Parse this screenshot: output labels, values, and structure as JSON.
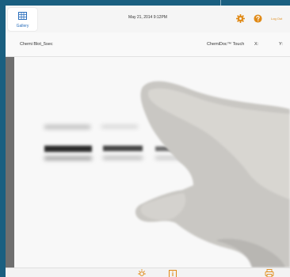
{
  "header": {
    "gallery_label": "Gallery",
    "datetime": "May 21, 2014  9:12PM",
    "logout_label": "Log Out"
  },
  "infobar": {
    "image_name": "Chemi Blot_5sec",
    "device": "ChemiDoc™ Touch",
    "x_label": "X:",
    "y_label": "Y:"
  },
  "icons": {
    "gallery": "gallery-grid-icon",
    "settings": "gear-icon",
    "help": "help-icon",
    "brightness": "brightness-icon",
    "info": "info-icon",
    "print": "print-icon"
  },
  "colors": {
    "frame": "#1a5f80",
    "accent_orange": "#e08a17",
    "accent_blue": "#2a6ebb"
  }
}
